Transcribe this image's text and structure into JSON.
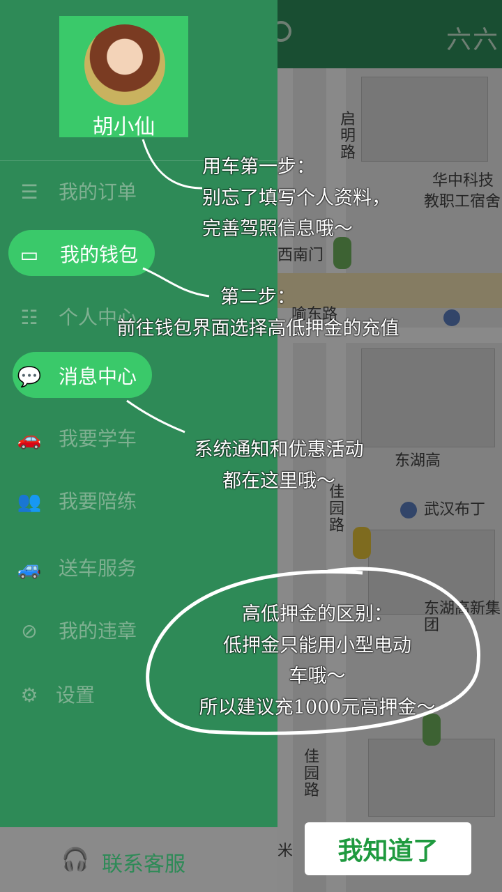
{
  "map": {
    "title_partial": "六六",
    "labels": {
      "road1": "启明路",
      "hust": "华中科技",
      "hust2": "教职工宿舍",
      "gate": "西南门",
      "road2": "喻东路",
      "east_lake": "东湖高",
      "road3": "佳园路",
      "hotel": "武汉布丁",
      "group": "东湖高新集团",
      "road4": "佳园路",
      "bottom": "米"
    }
  },
  "drawer": {
    "username": "胡小仙",
    "menu": [
      {
        "label": "我的订单",
        "icon": "list-icon"
      },
      {
        "label": "我的钱包",
        "icon": "wallet-icon"
      },
      {
        "label": "个人中心",
        "icon": "profile-icon"
      },
      {
        "label": "消息中心",
        "icon": "chat-icon"
      },
      {
        "label": "我要学车",
        "icon": "car-icon"
      },
      {
        "label": "我要陪练",
        "icon": "users-icon"
      },
      {
        "label": "送车服务",
        "icon": "delivery-car-icon"
      },
      {
        "label": "我的违章",
        "icon": "violation-icon"
      },
      {
        "label": "设置",
        "icon": "gear-icon"
      }
    ],
    "contact_label": "联系客服"
  },
  "notes": {
    "step1_line1": "用车第一步：",
    "step1_line2": "别忘了填写个人资料，",
    "step1_line3": "完善驾照信息哦～",
    "step2_line1": "第二步：",
    "step2_line2": "前往钱包界面选择高低押金的充值",
    "msg_line1": "系统通知和优惠活动",
    "msg_line2": "都在这里哦～",
    "deposit_line1": "高低押金的区别：",
    "deposit_line2": "低押金只能用小型电动",
    "deposit_line3": "车哦～",
    "deposit_line4": "所以建议充1000元高押金～"
  },
  "got_it_label": "我知道了",
  "colors": {
    "drawer_bg": "#2e8a57",
    "highlight": "#3ac96a",
    "button_text": "#1f9a3f"
  }
}
